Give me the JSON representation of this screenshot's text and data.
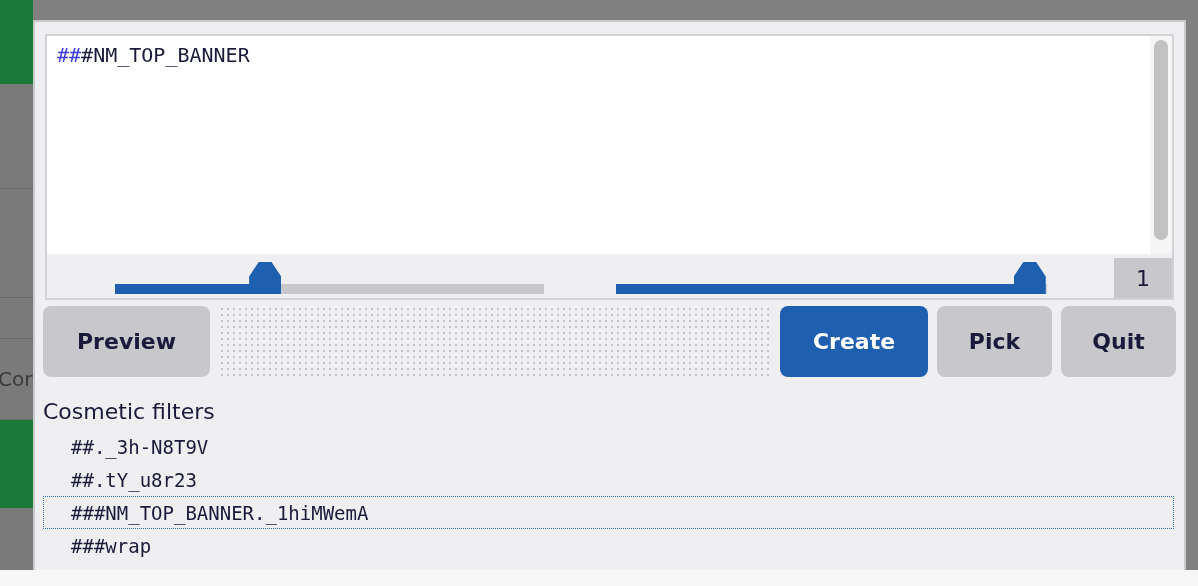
{
  "background_page": {
    "label": "Cor"
  },
  "editor": {
    "highlight": "##",
    "text": "#NM_TOP_BANNER"
  },
  "sliders": [
    {
      "level": 0.35
    },
    {
      "level": 0.96
    }
  ],
  "match_count": "1",
  "buttons": [
    {
      "label": "Preview",
      "primary": false
    },
    {
      "label": "Create",
      "primary": true
    },
    {
      "label": "Pick",
      "primary": false
    },
    {
      "label": "Quit",
      "primary": false
    }
  ],
  "section_title": "Cosmetic filters",
  "filters": [
    {
      "text": "##._3h-N8T9V",
      "selected": false
    },
    {
      "text": "##.tY_u8r23",
      "selected": false
    },
    {
      "text": "###NM_TOP_BANNER._1hiMWemA",
      "selected": true
    },
    {
      "text": "###wrap",
      "selected": false
    }
  ]
}
